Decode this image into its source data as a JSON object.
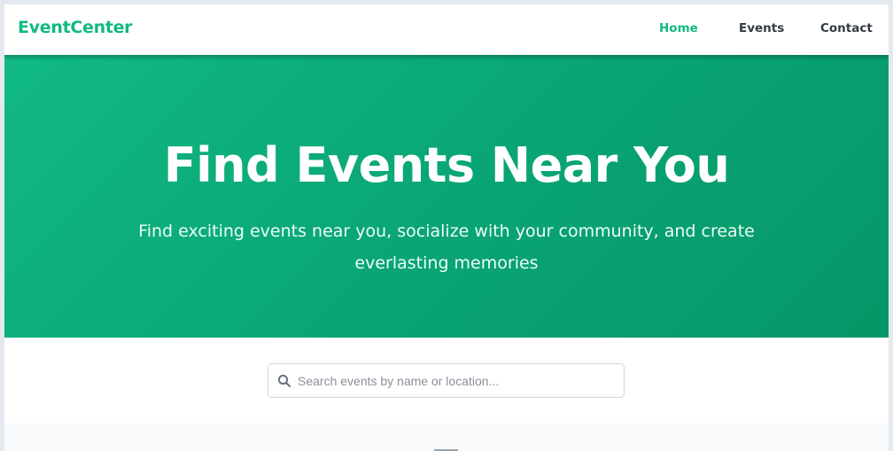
{
  "navbar": {
    "brand": "EventCenter",
    "links": [
      {
        "label": "Home",
        "active": true
      },
      {
        "label": "Events",
        "active": false
      },
      {
        "label": "Contact",
        "active": false
      }
    ]
  },
  "hero": {
    "title": "Find Events Near You",
    "subtitle": "Find exciting events near you, socialize with your community, and create everlasting memories"
  },
  "search": {
    "icon": "search-icon",
    "placeholder": "Search events by name or location...",
    "value": ""
  },
  "colors": {
    "accent": "#10b981",
    "hero_gradient_start": "#11b984",
    "hero_gradient_end": "#069668",
    "nav_text": "#333a44"
  }
}
